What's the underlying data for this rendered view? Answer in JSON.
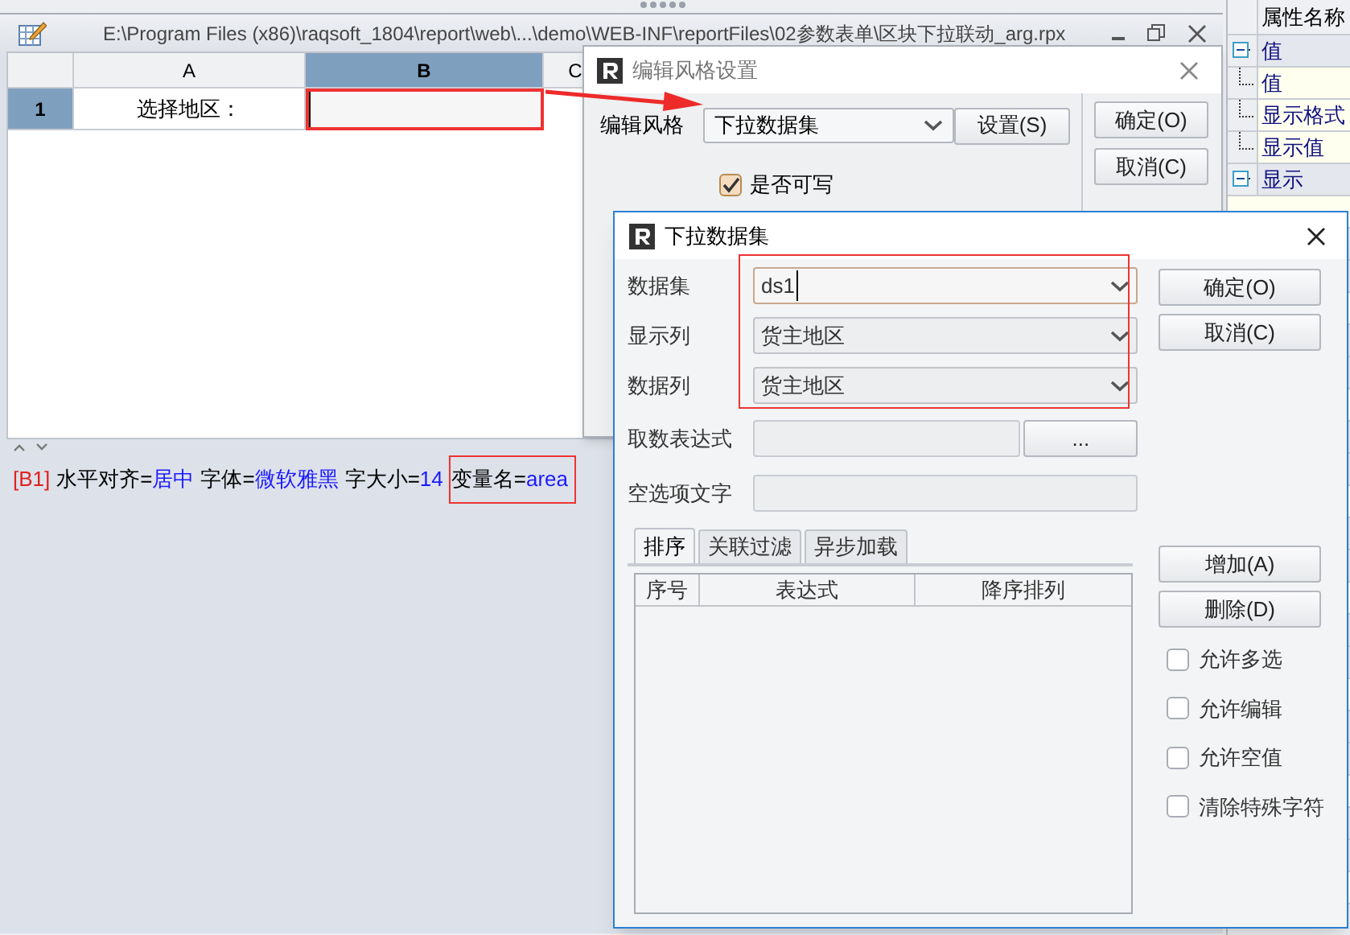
{
  "editor_window": {
    "title": "E:\\Program Files (x86)\\raqsoft_1804\\report\\web\\...\\demo\\WEB-INF\\reportFiles\\02参数表单\\区块下拉联动_arg.rpx",
    "columns": [
      {
        "label": "A",
        "selected": false
      },
      {
        "label": "B",
        "selected": true
      },
      {
        "label": "C",
        "selected": false
      }
    ],
    "rows": [
      {
        "header": "1",
        "selected": true,
        "cells": [
          {
            "text": "选择地区：",
            "selected": false
          },
          {
            "text": "",
            "selected": true
          }
        ]
      }
    ]
  },
  "expression_bar": {
    "cell_ref": "[B1]",
    "parts": [
      {
        "key": "水平对齐=",
        "value": "居中",
        "highlighted": false
      },
      {
        "key": "字体=",
        "value": "微软雅黑",
        "highlighted": false
      },
      {
        "key": "字大小=",
        "value": "14",
        "highlighted": false
      },
      {
        "key": "变量名=",
        "value": "area",
        "highlighted": true
      }
    ]
  },
  "properties": {
    "header": "属性名称",
    "items": [
      {
        "label": "值",
        "expanded": true,
        "children": [
          {
            "label": "值"
          },
          {
            "label": "显示格式"
          },
          {
            "label": "显示值"
          }
        ]
      },
      {
        "label": "显示",
        "expanded": true
      }
    ]
  },
  "style_dialog": {
    "title": "编辑风格设置",
    "style_label": "编辑风格",
    "style_value": "下拉数据集",
    "setup_button": "设置(S)",
    "buttons": [
      "确定(O)",
      "取消(C)"
    ],
    "writable": {
      "label": "是否可写",
      "checked": true
    }
  },
  "dataset_dialog": {
    "title": "下拉数据集",
    "fields": [
      {
        "label": "数据集",
        "value": "ds1",
        "kind": "combo"
      },
      {
        "label": "显示列",
        "value": "货主地区",
        "kind": "combo"
      },
      {
        "label": "数据列",
        "value": "货主地区",
        "kind": "combo"
      },
      {
        "label": "取数表达式",
        "kind": "browse",
        "button": "..."
      },
      {
        "label": "空选项文字",
        "kind": "text"
      }
    ],
    "tabs": [
      {
        "label": "排序",
        "selected": true
      },
      {
        "label": "关联过滤",
        "selected": false
      },
      {
        "label": "异步加载",
        "selected": false
      }
    ],
    "table": {
      "columns": [
        "序号",
        "表达式",
        "降序排列"
      ]
    },
    "buttons": [
      "确定(O)",
      "取消(C)"
    ],
    "list_buttons": [
      "增加(A)",
      "删除(D)"
    ],
    "options": [
      {
        "label": "允许多选",
        "checked": false
      },
      {
        "label": "允许编辑",
        "checked": false
      },
      {
        "label": "允许空值",
        "checked": false
      },
      {
        "label": "清除特殊字符",
        "checked": false
      }
    ]
  }
}
